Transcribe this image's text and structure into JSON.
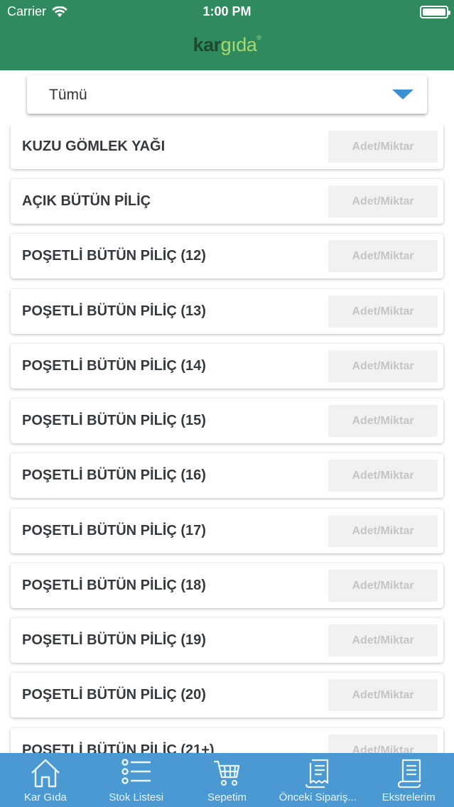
{
  "status_bar": {
    "carrier": "Carrier",
    "time": "1:00 PM"
  },
  "header": {
    "logo_part1": "kar",
    "logo_part2": "gıda",
    "logo_mark": "®"
  },
  "filter": {
    "selected": "Tümü"
  },
  "products": [
    {
      "name": "KUZU GÖMLEK YAĞI",
      "placeholder": "Adet/Miktar"
    },
    {
      "name": "AÇIK BÜTÜN PİLİÇ",
      "placeholder": "Adet/Miktar"
    },
    {
      "name": "POŞETLİ BÜTÜN PİLİÇ (12)",
      "placeholder": "Adet/Miktar"
    },
    {
      "name": "POŞETLİ BÜTÜN PİLİÇ (13)",
      "placeholder": "Adet/Miktar"
    },
    {
      "name": "POŞETLİ BÜTÜN PİLİÇ (14)",
      "placeholder": "Adet/Miktar"
    },
    {
      "name": "POŞETLİ BÜTÜN PİLİÇ (15)",
      "placeholder": "Adet/Miktar"
    },
    {
      "name": "POŞETLİ BÜTÜN PİLİÇ (16)",
      "placeholder": "Adet/Miktar"
    },
    {
      "name": "POŞETLİ BÜTÜN PİLİÇ (17)",
      "placeholder": "Adet/Miktar"
    },
    {
      "name": "POŞETLİ BÜTÜN PİLİÇ (18)",
      "placeholder": "Adet/Miktar"
    },
    {
      "name": "POŞETLİ BÜTÜN PİLİÇ (19)",
      "placeholder": "Adet/Miktar"
    },
    {
      "name": "POŞETLİ BÜTÜN PİLİÇ (20)",
      "placeholder": "Adet/Miktar"
    },
    {
      "name": "POŞETLİ BÜTÜN PİLİÇ (21+)",
      "placeholder": "Adet/Miktar"
    }
  ],
  "tabbar": [
    {
      "label": "Kar Gıda",
      "icon": "home-icon"
    },
    {
      "label": "Stok Listesi",
      "icon": "list-icon"
    },
    {
      "label": "Sepetim",
      "icon": "cart-icon"
    },
    {
      "label": "Önceki Sipariş...",
      "icon": "receipt-icon"
    },
    {
      "label": "Ekstrelerim",
      "icon": "document-icon"
    }
  ],
  "colors": {
    "header": "#2f8a5d",
    "tabbar": "#4a99d3",
    "caret": "#3b8fd4"
  }
}
